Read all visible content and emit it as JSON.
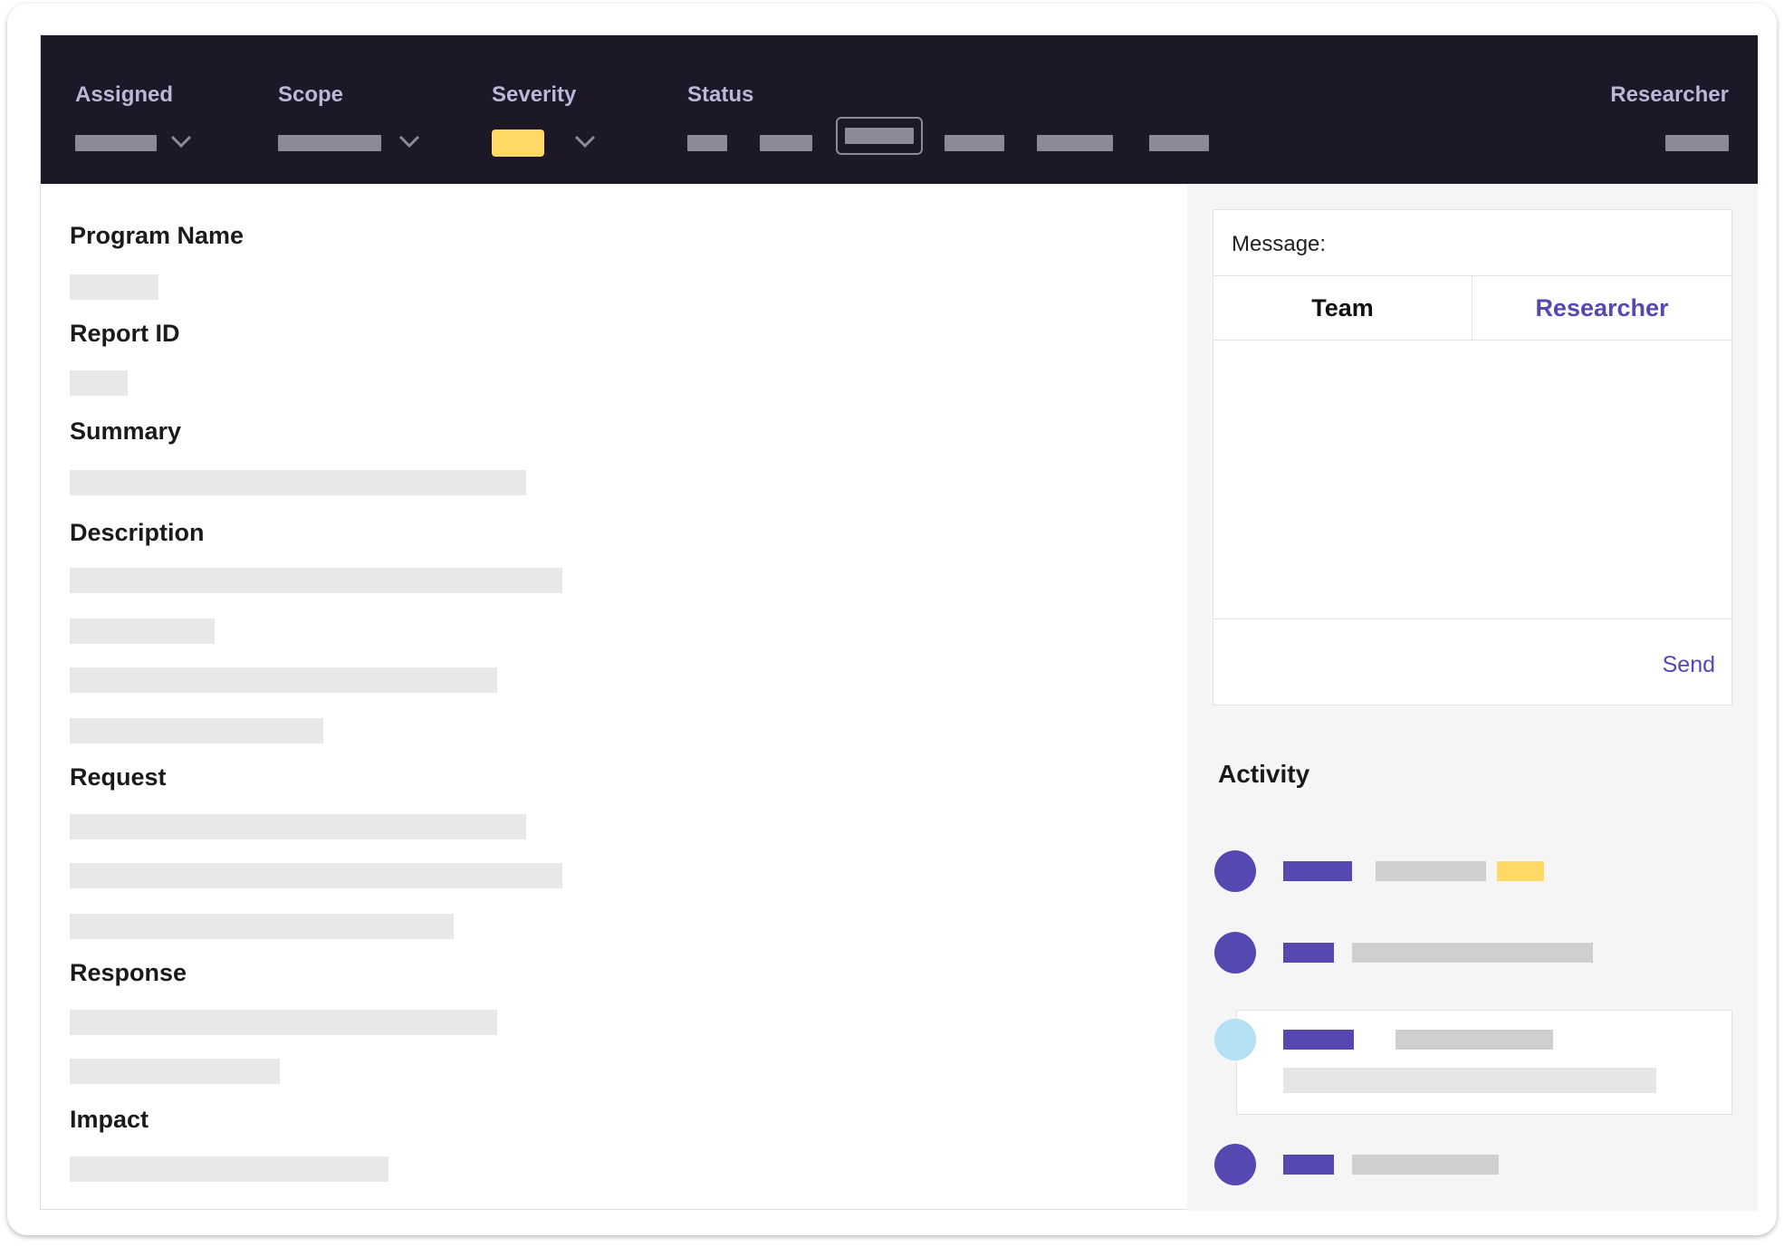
{
  "topbar": {
    "assigned_label": "Assigned",
    "scope_label": "Scope",
    "severity_label": "Severity",
    "status_label": "Status",
    "researcher_label": "Researcher",
    "icons": {
      "dropdown": "chevron-down-icon"
    },
    "colors": {
      "background": "#1c1827",
      "label": "#b9b8d6",
      "severity_chip": "#ffd966"
    }
  },
  "report": {
    "sections": {
      "program_name": "Program Name",
      "report_id": "Report ID",
      "summary": "Summary",
      "description": "Description",
      "request": "Request",
      "response": "Response",
      "impact": "Impact"
    }
  },
  "message": {
    "label": "Message:",
    "tabs": [
      "Team",
      "Researcher"
    ],
    "active_tab": "Researcher",
    "send_label": "Send",
    "accent_color": "#5548b0"
  },
  "activity": {
    "title": "Activity",
    "colors": {
      "actor": "#5548b0",
      "highlight": "#ffd966",
      "pending_dot": "#b3e0f2"
    }
  }
}
